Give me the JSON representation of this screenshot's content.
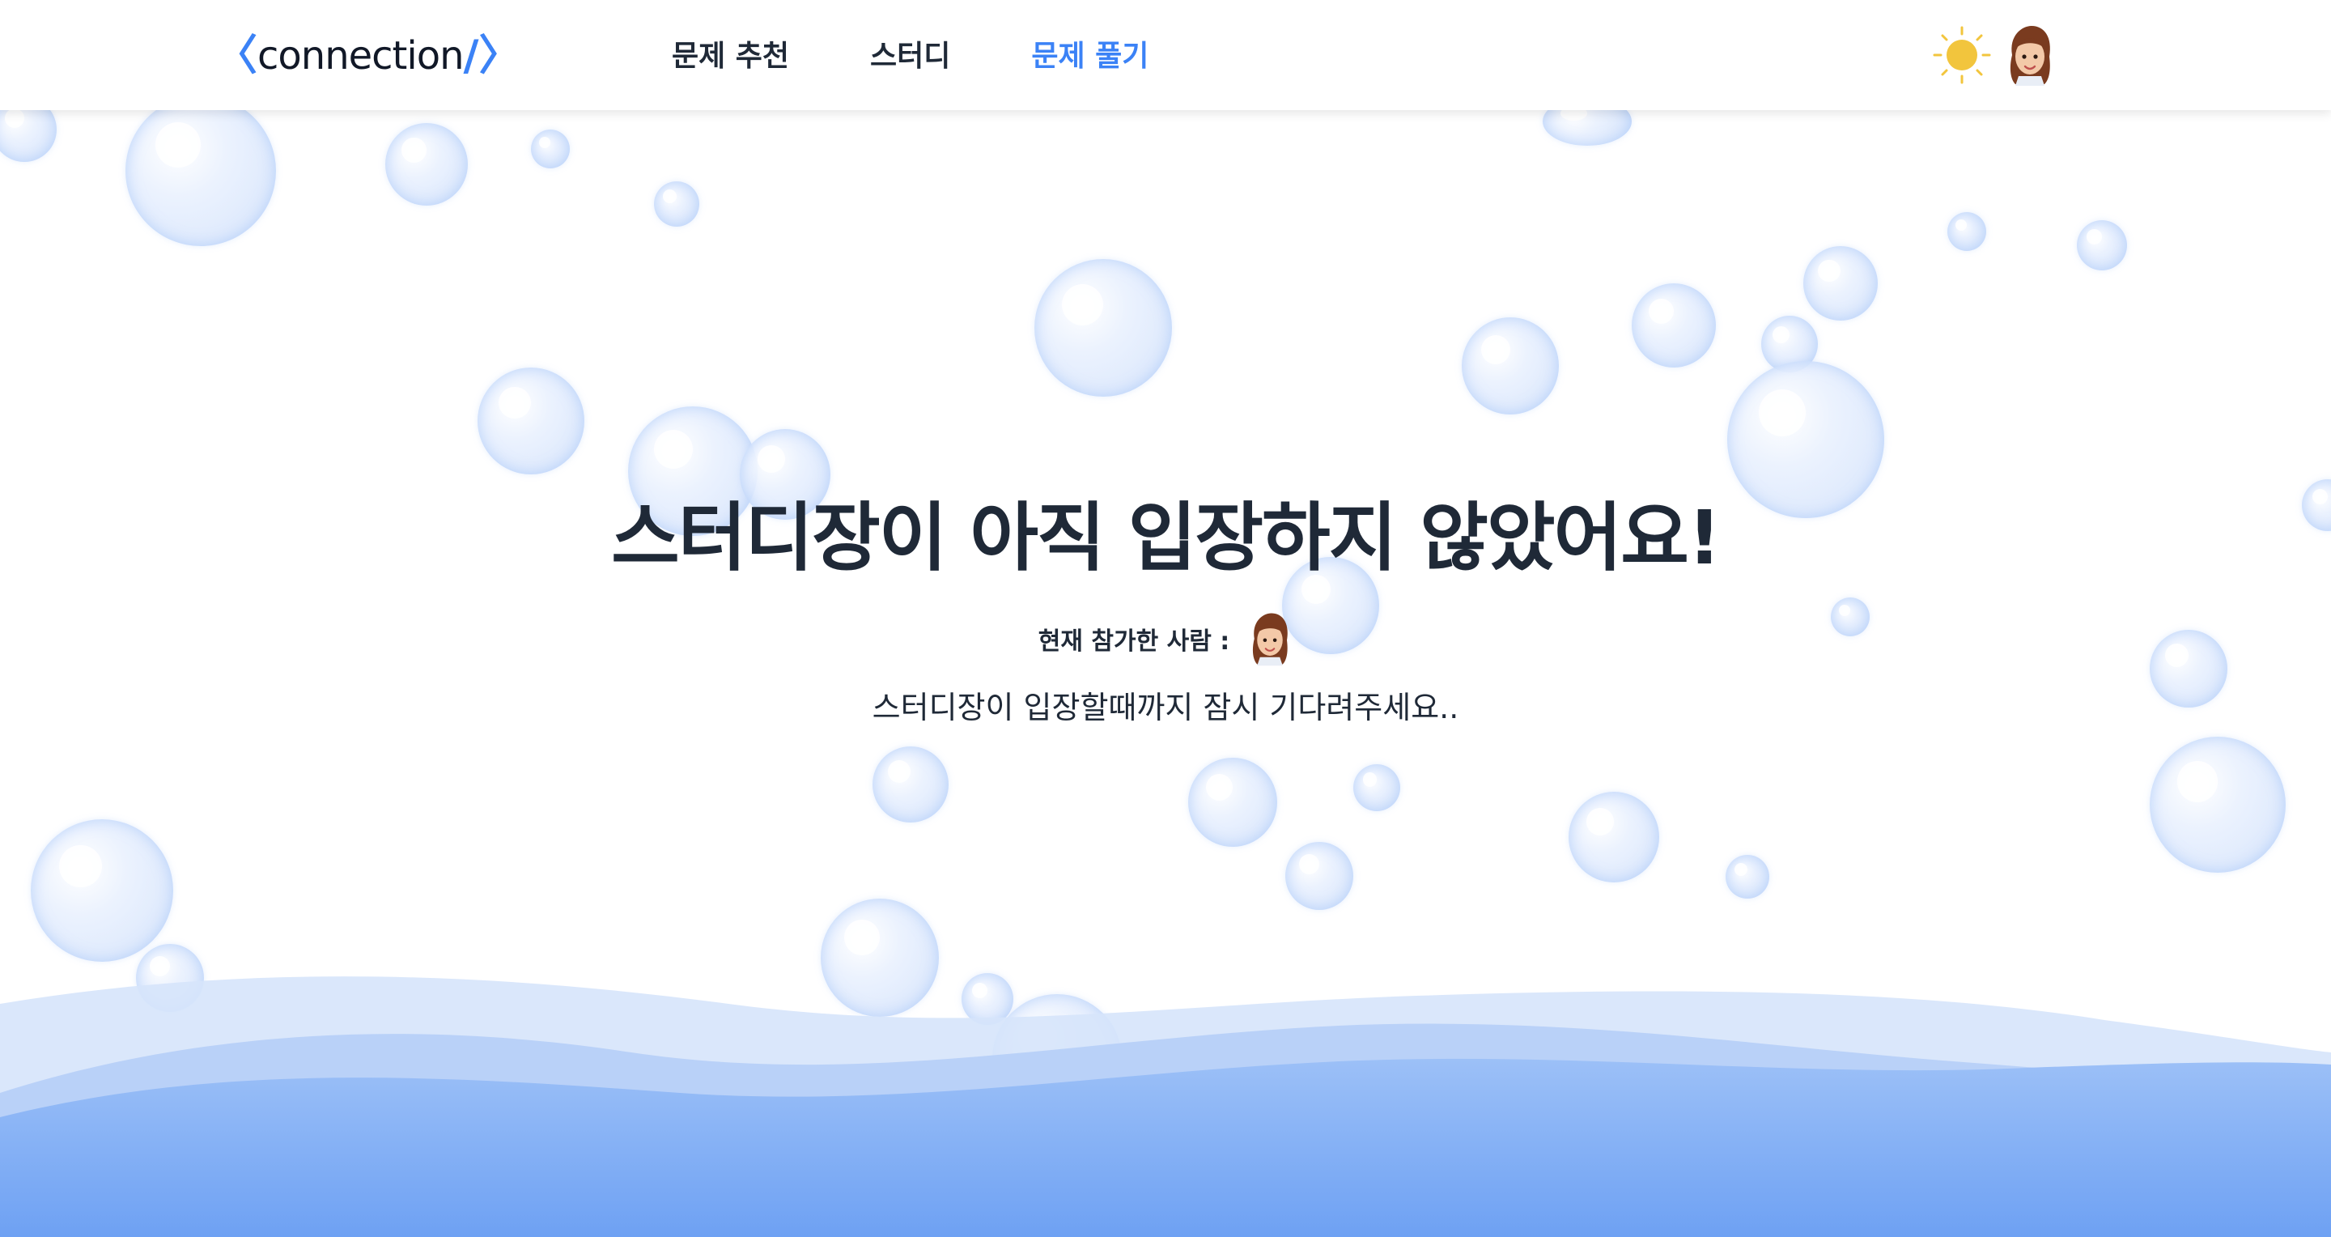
{
  "header": {
    "logo": {
      "open_bracket": "〈",
      "text": "connection",
      "close_bracket": "/〉"
    },
    "nav": [
      {
        "label": "문제 추천",
        "active": false
      },
      {
        "label": "스터디",
        "active": false
      },
      {
        "label": "문제 풀기",
        "active": true
      }
    ],
    "theme_icon": "sun-icon",
    "avatar_icon": "memoji-avatar"
  },
  "main": {
    "title": "스터디장이 아직 입장하지 않았어요!",
    "participants_label": "현재 참가한 사람 :",
    "wait_message": "스터디장이 입장할때까지 잠시 기다려주세요.."
  },
  "colors": {
    "accent": "#3b82f6",
    "text": "#1f2937",
    "wave_light": "#cfe0fb",
    "wave_mid": "#a9c8f8",
    "wave_deep": "#6ea1f3",
    "sun": "#f2c53d"
  }
}
